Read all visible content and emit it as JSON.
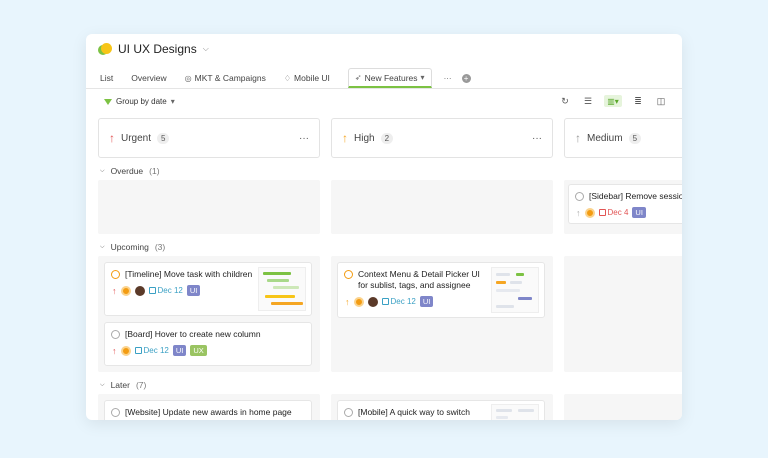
{
  "workspace": {
    "title": "UI UX Designs"
  },
  "tabs": [
    {
      "label": "List",
      "icon": "",
      "active": false
    },
    {
      "label": "Overview",
      "icon": "",
      "active": false
    },
    {
      "label": "MKT & Campaigns",
      "icon": "target-icon",
      "active": false
    },
    {
      "label": "Mobile UI",
      "icon": "leaf-icon",
      "active": false
    },
    {
      "label": "New Features",
      "icon": "rocket-icon",
      "active": true
    }
  ],
  "tabs_more": "···",
  "toolbar": {
    "group_by": "Group by date"
  },
  "columns": [
    {
      "name": "Urgent",
      "count": "5",
      "arrow_color": "#e25454",
      "more": "···"
    },
    {
      "name": "High",
      "count": "2",
      "arrow_color": "#f5a623",
      "more": "···"
    },
    {
      "name": "Medium",
      "count": "5",
      "arrow_color": "#999999",
      "more": ""
    }
  ],
  "groups": [
    {
      "name": "Overdue",
      "count": "(1)"
    },
    {
      "name": "Upcoming",
      "count": "(3)"
    },
    {
      "name": "Later",
      "count": "(7)"
    }
  ],
  "cards": {
    "overdue_medium": {
      "title": "[Sidebar] Remove session",
      "date": "Dec 4",
      "tags": [
        "UI"
      ]
    },
    "upcoming_urgent_1": {
      "title": "[Timeline] Move task with children",
      "date": "Dec 12",
      "tags": [
        "UI"
      ]
    },
    "upcoming_urgent_2": {
      "title": "[Board] Hover to create new column",
      "date": "Dec 12",
      "tags": [
        "UI",
        "UX"
      ]
    },
    "upcoming_high_1": {
      "title_line1": "Context Menu & Detail Picker UI",
      "title_line2": "for sublist, tags, and assignee",
      "date": "Dec 12",
      "tags": [
        "UI"
      ]
    },
    "later_urgent_1": {
      "title": "[Website] Update new awards in home page"
    },
    "later_high_1": {
      "title": "[Mobile] A quick way to switch"
    }
  },
  "colors": {
    "accent": "#7cc243",
    "urgent": "#e25454",
    "high": "#f5a623",
    "date": "#3aa0c4",
    "tag_ui": "#7f86c9",
    "tag_ux": "#9ac462"
  }
}
